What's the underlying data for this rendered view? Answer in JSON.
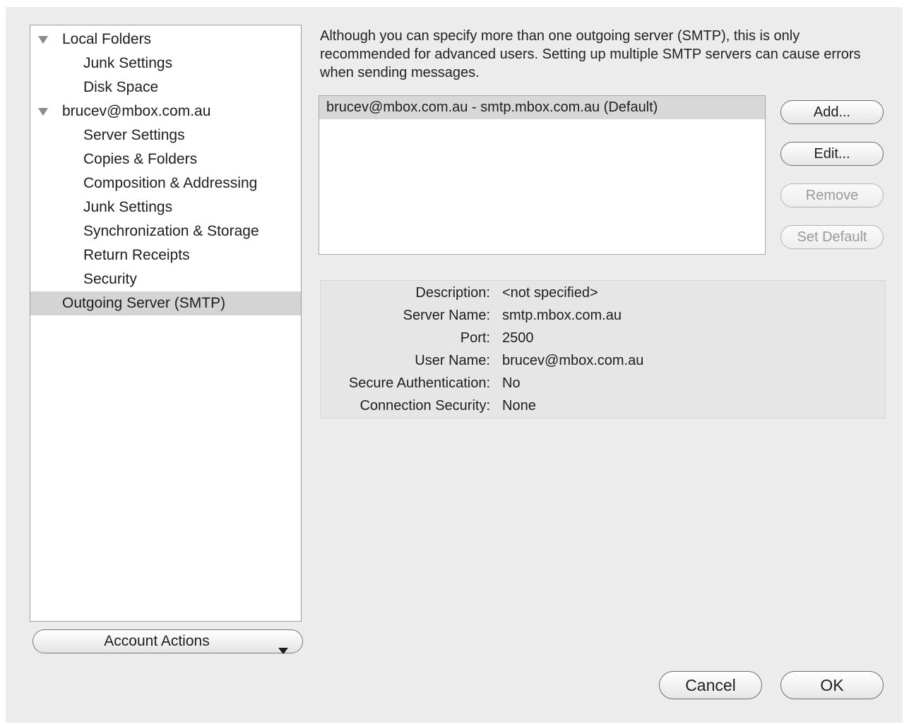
{
  "sidebar": {
    "items": [
      {
        "label": "Local Folders"
      },
      {
        "label": "Junk Settings"
      },
      {
        "label": "Disk Space"
      },
      {
        "label": "brucev@mbox.com.au"
      },
      {
        "label": "Server Settings"
      },
      {
        "label": "Copies & Folders"
      },
      {
        "label": "Composition & Addressing"
      },
      {
        "label": "Junk Settings"
      },
      {
        "label": "Synchronization & Storage"
      },
      {
        "label": "Return Receipts"
      },
      {
        "label": "Security"
      },
      {
        "label": "Outgoing Server (SMTP)"
      }
    ],
    "selected": "Outgoing Server (SMTP)",
    "account_actions_label": "Account Actions"
  },
  "main": {
    "intro": "Although you can specify more than one outgoing server (SMTP), this is only recommended for advanced users. Setting up multiple SMTP servers can cause errors when sending messages.",
    "smtp_servers": [
      {
        "label": "brucev@mbox.com.au - smtp.mbox.com.au (Default)",
        "selected": true
      }
    ],
    "buttons": {
      "add": "Add...",
      "edit": "Edit...",
      "remove": "Remove",
      "set_default": "Set Default"
    },
    "details": {
      "description_label": "Description:",
      "description_value": "<not specified>",
      "server_name_label": "Server Name:",
      "server_name_value": "smtp.mbox.com.au",
      "port_label": "Port:",
      "port_value": "2500",
      "user_name_label": "User Name:",
      "user_name_value": "brucev@mbox.com.au",
      "secure_auth_label": "Secure Authentication:",
      "secure_auth_value": "No",
      "connection_security_label": "Connection Security:",
      "connection_security_value": "None"
    }
  },
  "footer": {
    "cancel": "Cancel",
    "ok": "OK"
  },
  "colors": {
    "dialog_bg": "#ececec",
    "selection": "#d4d4d4"
  }
}
